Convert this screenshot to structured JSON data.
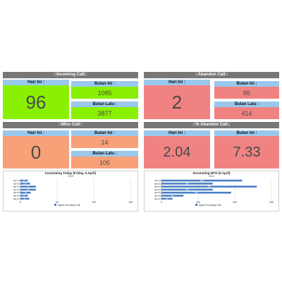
{
  "panels": {
    "incoming": {
      "title": "::Incoming Call::",
      "today_label": "Hari Ini :",
      "today_value": "96",
      "month_label": "Bulan Ini :",
      "month_value": "1085",
      "last_label": "Bulan Lalu :",
      "last_value": "3877"
    },
    "abandon": {
      "title": "::Abandon Call::",
      "today_label": "Hari Ini :",
      "today_value": "2",
      "month_label": "Bulan Ini :",
      "month_value": "86",
      "last_label": "Bulan Lalu :",
      "last_value": "414"
    },
    "miss": {
      "title": "::Miss Call::",
      "today_label": "Hari Ini :",
      "today_value": "0",
      "month_label": "Bulan Ini :",
      "month_value": "14",
      "last_label": "Bulan Lalu :",
      "last_value": "105"
    },
    "pct_abandon": {
      "title": "::% Abandon Call::",
      "today_label": "Hari Ini :",
      "month_label": "Bulan Ini :",
      "today_value": "2.04",
      "month_value": "7.33"
    }
  },
  "colors": {
    "incoming": "#88f000",
    "abandon": "#f08282",
    "miss": "#f8a078",
    "label_bar": "#9ac8ec",
    "title_bar": "#777777",
    "bar_series": "#4a7fc4"
  },
  "chart_data": [
    {
      "type": "bar",
      "orientation": "horizontal",
      "title": "Incomming Today (Friday, 5 April)",
      "subtitle": "2013",
      "categories": [
        "agent1",
        "agent2",
        "agent3",
        "agent4",
        "agent5",
        "agent6",
        "agent7"
      ],
      "series": [
        {
          "name": "Agent Incoming Call",
          "values": [
            10,
            13,
            21,
            21,
            14,
            10,
            12
          ]
        }
      ],
      "xlim": [
        0,
        150
      ],
      "xticks": [
        0,
        50,
        100,
        150
      ],
      "grid": true,
      "legend": "bottom"
    },
    {
      "type": "bar",
      "orientation": "horizontal",
      "title": "Incomming MTD (5 April)",
      "subtitle": "2013",
      "categories": [
        "agent1",
        "agent2",
        "agent3",
        "agent4",
        "agent5",
        "agent6",
        "agent7"
      ],
      "series": [
        {
          "name": "Agent Incoming Call",
          "values": [
            220,
            140,
            260,
            140,
            190,
            60,
            30
          ]
        }
      ],
      "xlim": [
        0,
        300
      ],
      "xticks": [
        0,
        100,
        200,
        300
      ],
      "grid": true,
      "legend": "bottom"
    }
  ]
}
